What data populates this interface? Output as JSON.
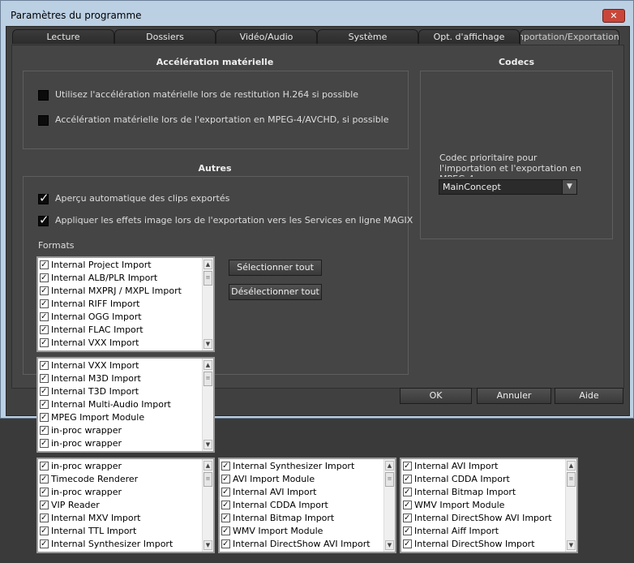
{
  "window": {
    "title": "Paramètres du programme",
    "close_glyph": "✕"
  },
  "tabs": [
    {
      "label": "Lecture"
    },
    {
      "label": "Dossiers"
    },
    {
      "label": "Vidéo/Audio"
    },
    {
      "label": "Système"
    },
    {
      "label": "Opt. d'affichage"
    },
    {
      "label": "Importation/Exportation",
      "active": true
    }
  ],
  "hw_accel": {
    "title": "Accélération matérielle",
    "option1": "Utilisez l'accélération matérielle lors de restitution H.264 si possible",
    "option2": "Accélération matérielle lors de l'exportation en MPEG-4/AVCHD, si possible"
  },
  "codecs": {
    "title": "Codecs",
    "priority_label": "Codec prioritaire pour l'importation et l'exportation en MPEG-4",
    "selected": "MainConcept"
  },
  "autres": {
    "title": "Autres",
    "option1": "Aperçu automatique des clips exportés",
    "option2": "Appliquer les effets image lors de l'exportation vers les Services en ligne MAGIX",
    "formats_label": "Formats",
    "select_all": "Sélectionner tout",
    "deselect_all": "Désélectionner tout"
  },
  "buttons": {
    "ok": "OK",
    "cancel": "Annuler",
    "help": "Aide"
  },
  "lists": [
    [
      "Internal Project Import",
      "Internal ALB/PLR Import",
      "Internal MXPRJ / MXPL Import",
      "Internal RIFF Import",
      "Internal OGG Import",
      "Internal FLAC Import",
      "Internal VXX Import"
    ],
    [
      "Internal VXX Import",
      "Internal M3D Import",
      "Internal T3D Import",
      "Internal Multi-Audio Import",
      "MPEG Import Module",
      "in-proc wrapper",
      "in-proc wrapper"
    ],
    [
      "in-proc wrapper",
      "Timecode Renderer",
      "in-proc wrapper",
      "VIP Reader",
      "Internal MXV Import",
      "Internal TTL Import",
      "Internal Synthesizer Import"
    ],
    [
      "Internal Synthesizer Import",
      "AVI Import Module",
      "Internal AVI Import",
      "Internal CDDA Import",
      "Internal Bitmap Import",
      "WMV Import Module",
      "Internal DirectShow AVI Import"
    ],
    [
      "Internal AVI Import",
      "Internal CDDA Import",
      "Internal Bitmap Import",
      "WMV Import Module",
      "Internal DirectShow AVI Import",
      "Internal Aiff Import",
      "Internal DirectShow Import"
    ]
  ]
}
